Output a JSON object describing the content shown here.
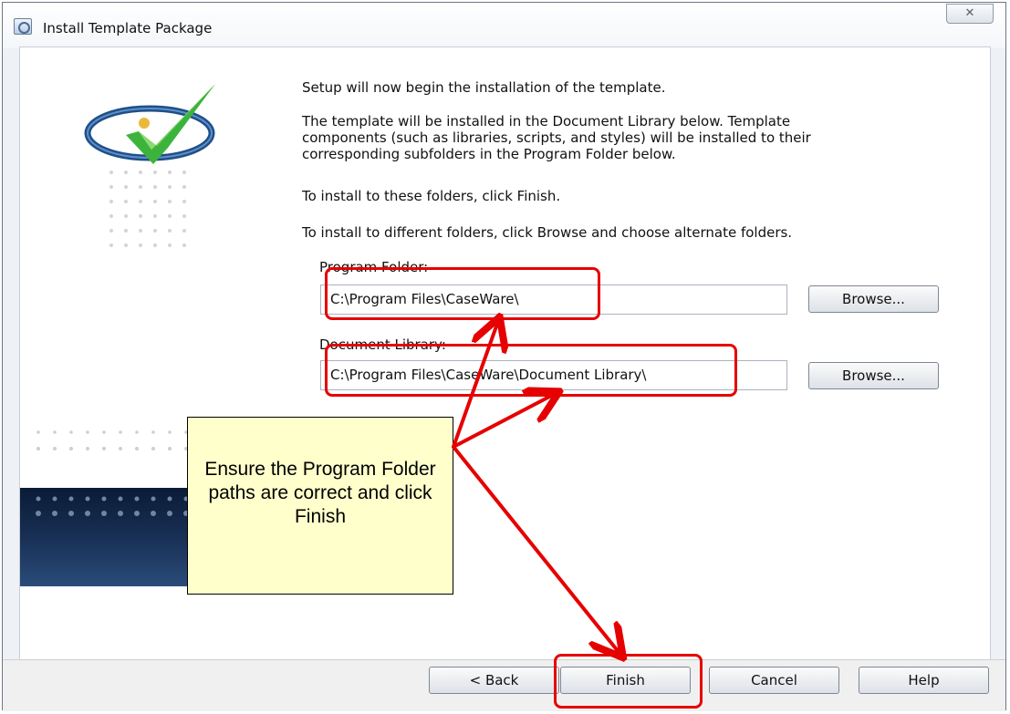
{
  "window": {
    "title": "Install Template Package",
    "close_glyph": "✕"
  },
  "intro": {
    "line1": "Setup will now begin the installation of the template.",
    "line2": "The template will be installed in the Document Library below.  Template",
    "line3": "components (such as libraries, scripts, and styles) will be installed to their",
    "line4": "corresponding subfolders in the Program Folder below.",
    "line5": "To install to these folders, click Finish.",
    "line6": "To install to different folders, click Browse and choose alternate folders."
  },
  "fields": {
    "program_folder": {
      "label": "Program Folder:",
      "value": "C:\\Program Files\\CaseWare\\",
      "browse_label": "Browse..."
    },
    "document_library": {
      "label": "Document Library:",
      "value": "C:\\Program Files\\CaseWare\\Document Library\\",
      "browse_label": "Browse..."
    }
  },
  "footer": {
    "back_label": "< Back",
    "finish_label": "Finish",
    "cancel_label": "Cancel",
    "help_label": "Help"
  },
  "callout": {
    "text": "Ensure the Program Folder paths are correct and click Finish"
  },
  "colors": {
    "highlight": "#e60000",
    "callout_bg": "#ffffcc",
    "checkmark": "#3cb43c"
  },
  "icons": {
    "app": "app-window-icon",
    "close": "close-icon",
    "logo": "checkmark-logo-icon"
  }
}
